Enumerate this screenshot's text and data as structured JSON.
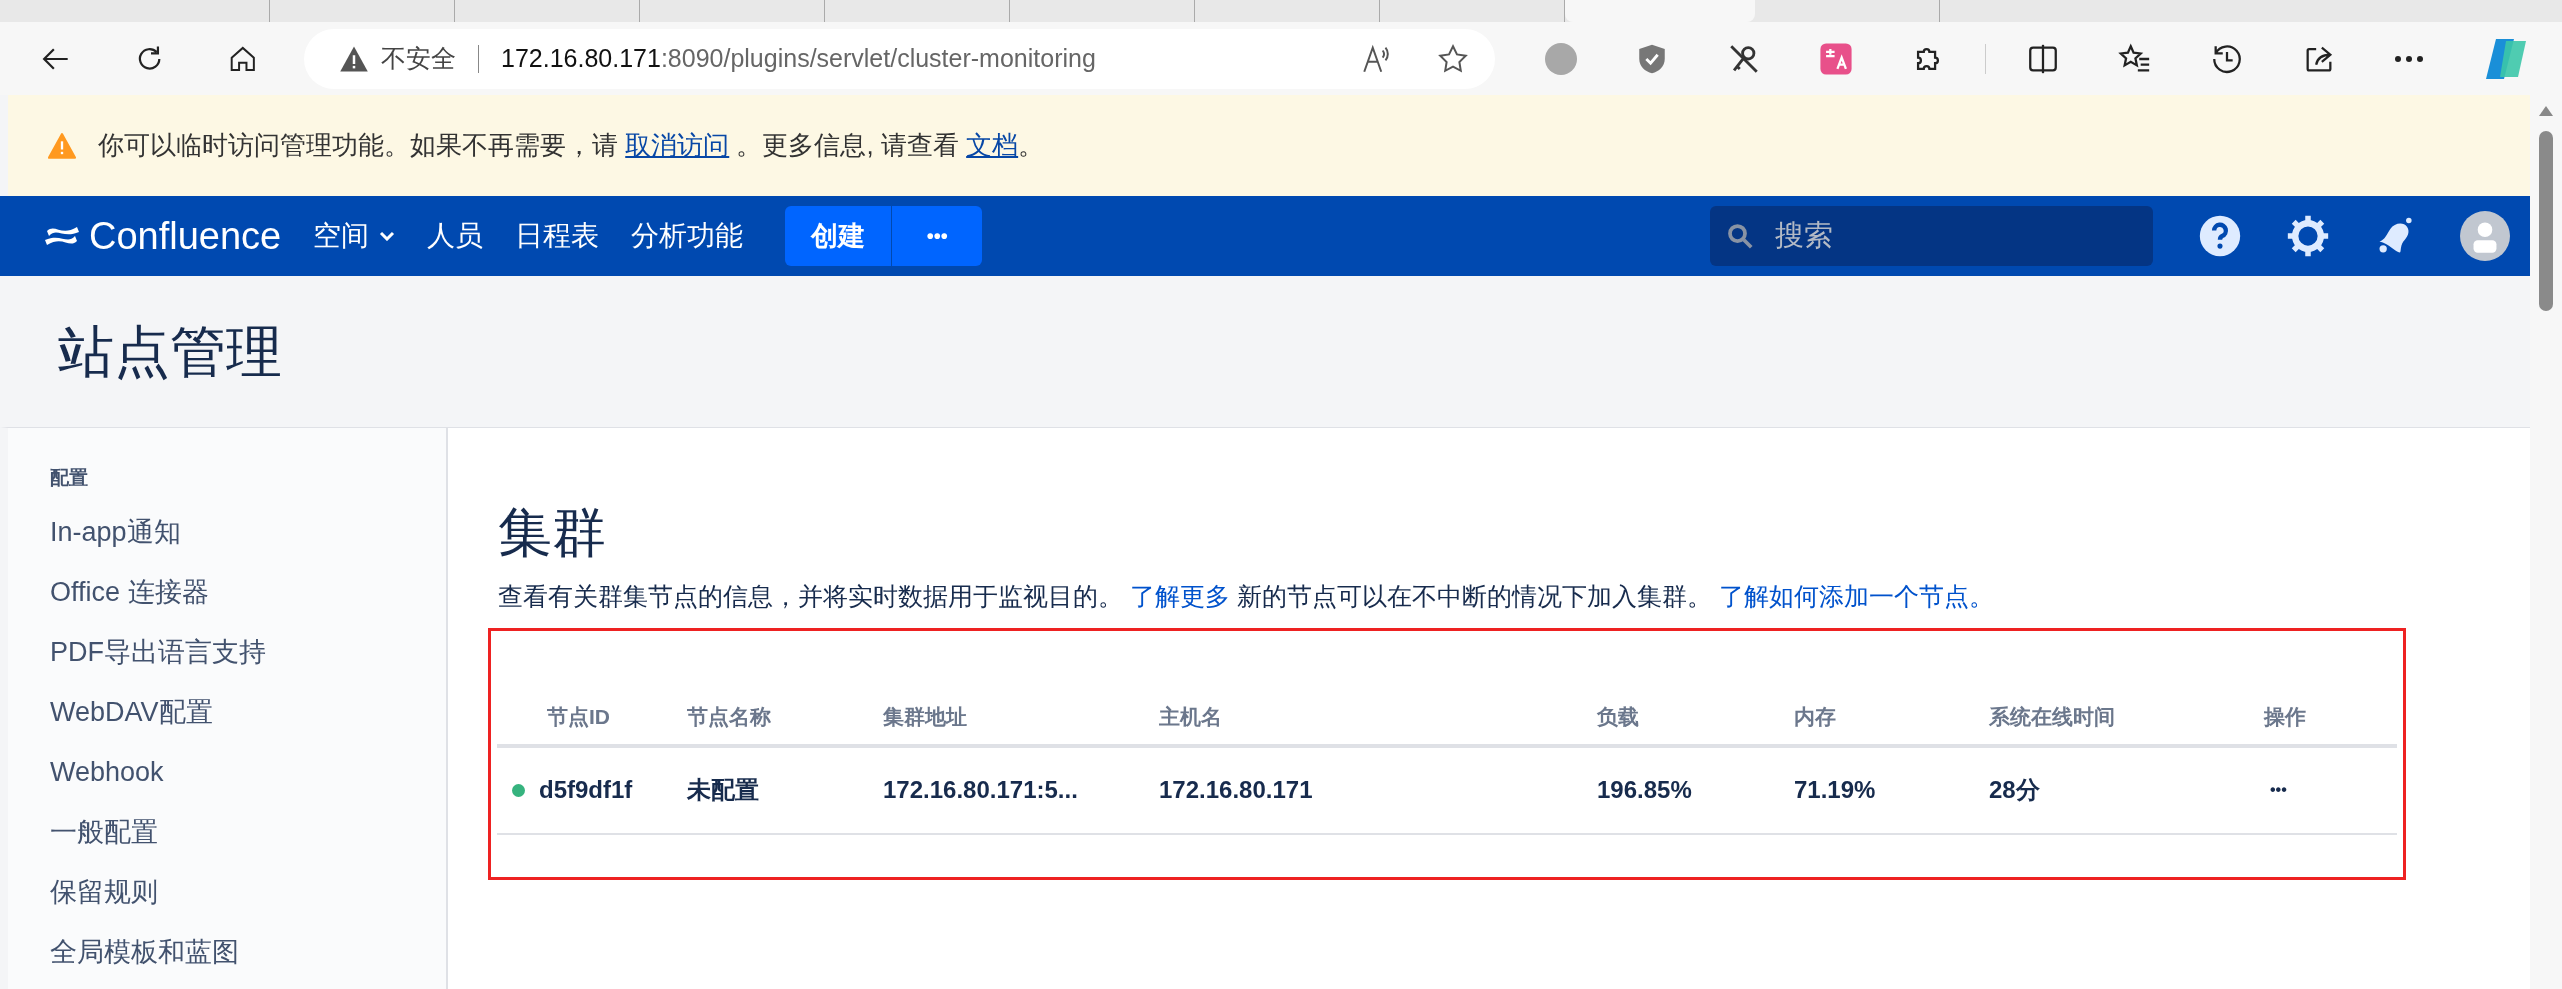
{
  "browser": {
    "tabs": [
      {
        "selected": false
      },
      {
        "selected": false
      },
      {
        "selected": false
      },
      {
        "selected": false
      },
      {
        "selected": false
      },
      {
        "selected": false
      },
      {
        "selected": false
      },
      {
        "selected": false
      },
      {
        "selected": true
      },
      {
        "selected": false
      }
    ],
    "address": {
      "security_label": "不安全",
      "host": "172.16.80.171",
      "path": ":8090/plugins/servlet/cluster-monitoring"
    }
  },
  "banner": {
    "parts": [
      {
        "kind": "text",
        "text": "你可以临时访问管理功能。如果不再需要，请 "
      },
      {
        "kind": "link",
        "text": "取消访问"
      },
      {
        "kind": "text",
        "text": " 。更多信息, 请查看 "
      },
      {
        "kind": "link",
        "text": "文档"
      },
      {
        "kind": "text",
        "text": "。"
      }
    ]
  },
  "nav": {
    "logo": "Confluence",
    "items": [
      {
        "label": "空间",
        "dropdown": true
      },
      {
        "label": "人员",
        "dropdown": false
      },
      {
        "label": "日程表",
        "dropdown": false
      },
      {
        "label": "分析功能",
        "dropdown": false
      }
    ],
    "create_button": "创建",
    "more_button": "•••",
    "search": {
      "placeholder": "搜索"
    }
  },
  "page_title": "站点管理",
  "sidebar": {
    "heading": "配置",
    "items": [
      "In-app通知",
      "Office 连接器",
      "PDF导出语言支持",
      "WebDAV配置",
      "Webhook",
      "一般配置",
      "保留规则",
      "全局模板和蓝图"
    ]
  },
  "main": {
    "title": "集群",
    "description": [
      {
        "kind": "text",
        "text": "查看有关群集节点的信息，并将实时数据用于监视目的。"
      },
      {
        "kind": "link",
        "text": "了解更多"
      },
      {
        "kind": "text",
        "text": "新的节点可以在不中断的情况下加入集群。"
      },
      {
        "kind": "link",
        "text": "了解如何添加一个节点。"
      }
    ],
    "table": {
      "columns": [
        "节点ID",
        "节点名称",
        "集群地址",
        "主机名",
        "负载",
        "内存",
        "系统在线时间",
        "操作"
      ],
      "rows": [
        {
          "color": "#36b37e",
          "cells": [
            "d5f9df1f",
            "未配置",
            "172.16.80.171:5...",
            "172.16.80.171",
            "196.85%",
            "71.19%",
            "28分",
            "•••"
          ]
        }
      ]
    }
  }
}
